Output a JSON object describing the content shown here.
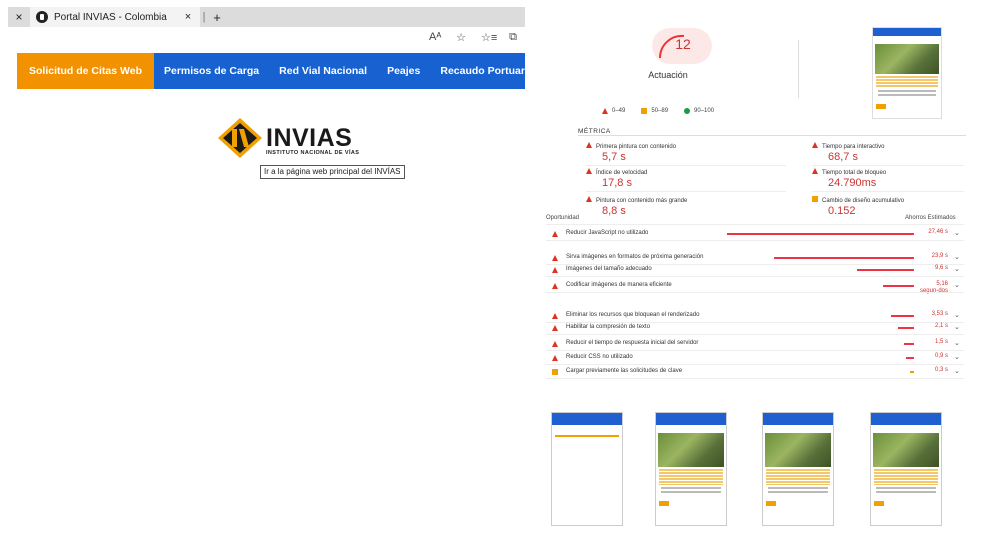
{
  "browser": {
    "tab_close_left": "×",
    "tab_title": "Portal INVÍAS - Colombia",
    "tab_close": "×",
    "tab_sep": "|",
    "new_tab": "+",
    "toolbar_icons": [
      "read-aloud-icon",
      "favorite-star-icon",
      "favorites-list-icon",
      "collections-icon"
    ],
    "toolbar_glyphs": [
      "Aᴬ",
      "☆",
      "☆≡",
      "⧉"
    ]
  },
  "navbar": {
    "items": [
      {
        "label": "Solicitud de Citas Web",
        "active": true
      },
      {
        "label": "Permisos de Carga"
      },
      {
        "label": "Red Vial Nacional"
      },
      {
        "label": "Peajes"
      },
      {
        "label": "Recaudo Portuario"
      }
    ],
    "colors": {
      "bg": "#1761d1",
      "active": "#f39200"
    }
  },
  "logo": {
    "word": "INVIAS",
    "sub": "INSTITUTO NACIONAL DE VÍAS",
    "tooltip": "Ir a la página web principal del INVÍAS"
  },
  "report": {
    "score": "12",
    "title": "Actuación",
    "legend": [
      "0–49",
      "50–89",
      "90–100"
    ],
    "metrics_heading": "MÉTRICA",
    "metrics": [
      {
        "label": "Primera pintura con contenido",
        "value": "5,7 s"
      },
      {
        "label": "Tiempo para interactivo",
        "value": "68,7 s"
      },
      {
        "label": "Índice de velocidad",
        "value": "17,8 s"
      },
      {
        "label": "Tiempo total de bloqueo",
        "value": "24.790ms"
      },
      {
        "label": "Pintura con contenido más grande",
        "value": "8,8 s"
      },
      {
        "label": "Cambio de diseño acumulativo",
        "value": "0.152"
      }
    ],
    "opportunity_heading": "Oportunidad",
    "savings_heading": "Ahorros Estimados",
    "opportunities": [
      {
        "label": "Reducir JavaScript no utilizado",
        "value": "27,46 s",
        "severity": "red",
        "bar": 0.36
      },
      {
        "label": "Sirva imágenes en formatos de próxima generación",
        "value": "23,9 s",
        "severity": "red",
        "bar": 0.27
      },
      {
        "label": "Imágenes del tamaño adecuado",
        "value": "9,6 s",
        "severity": "red",
        "bar": 0.11
      },
      {
        "label": "Codificar imágenes de manera eficiente",
        "value": "5,16 segun-dos",
        "severity": "red",
        "bar": 0.06
      },
      {
        "label": "Eliminar los recursos que bloquean el renderizado",
        "value": "3,53 s",
        "severity": "red",
        "bar": 0.045
      },
      {
        "label": "Habilitar la compresión de texto",
        "value": "2,1 s",
        "severity": "red",
        "bar": 0.03
      },
      {
        "label": "Reducir el tiempo de respuesta inicial del servidor",
        "value": "1,5 s",
        "severity": "red",
        "bar": 0.02
      },
      {
        "label": "Reducir CSS no utilizado",
        "value": "0,9 s",
        "severity": "red",
        "bar": 0.015
      },
      {
        "label": "Cargar previamente las solicitudes de clave",
        "value": "0,3 s",
        "severity": "orange",
        "bar": 0.006
      }
    ]
  }
}
